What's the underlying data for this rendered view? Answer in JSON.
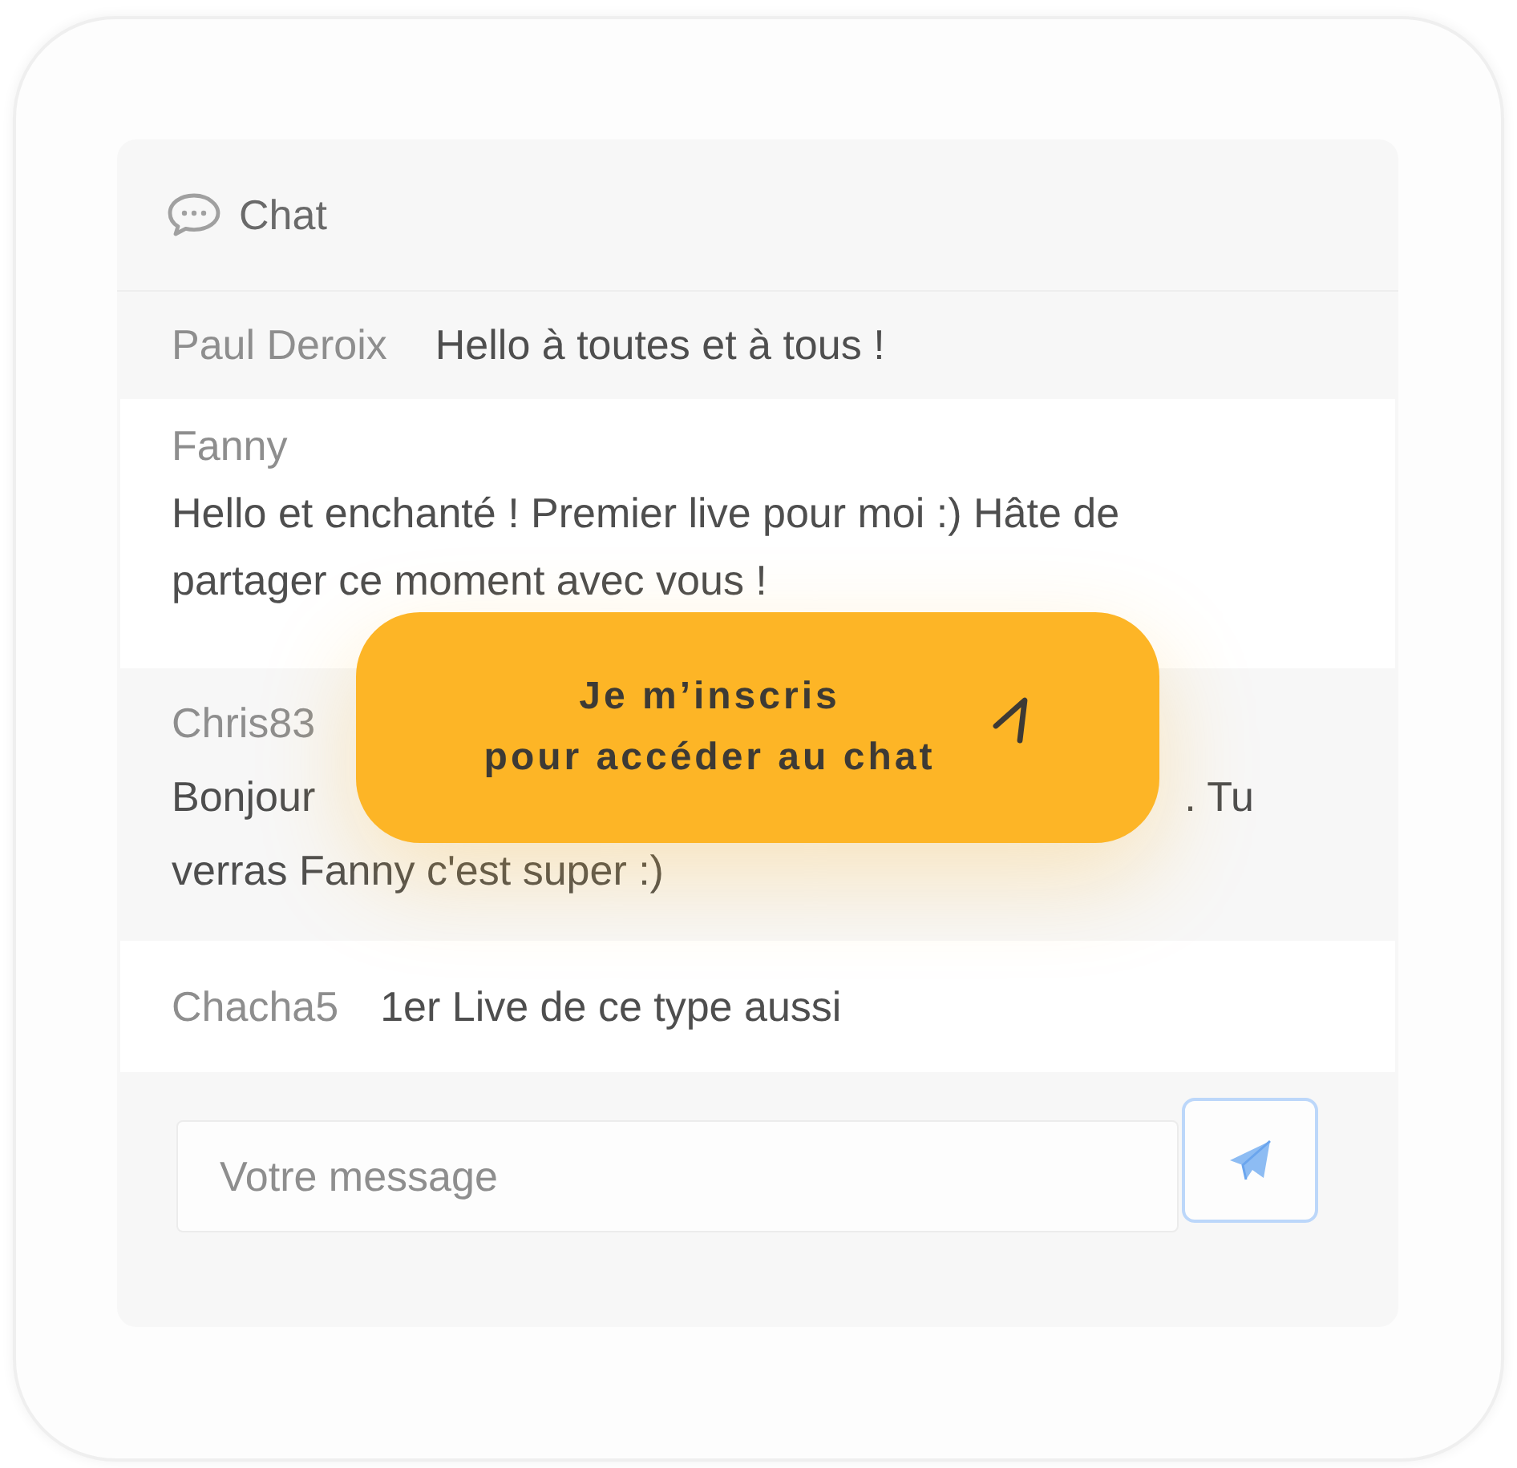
{
  "chat": {
    "title": "Chat",
    "messages": [
      {
        "author": "Paul Deroix",
        "kind": "inline",
        "lines": [
          [
            "Hello à toutes et à tous !"
          ]
        ]
      },
      {
        "author": "Fanny",
        "kind": "block",
        "lines": [
          [
            "Hello et enchanté ! Premier live pour moi :) Hâte de"
          ],
          [
            "partager ce moment avec vous !"
          ]
        ]
      },
      {
        "author": "Chris83",
        "kind": "block",
        "lines": [
          [
            "Bonjour",
            ". Tu"
          ],
          [
            "verras Fanny c'est super :)"
          ]
        ]
      },
      {
        "author": "Chacha5",
        "kind": "inline",
        "lines": [
          [
            "1er Live de ce type aussi"
          ]
        ]
      }
    ],
    "composer": {
      "placeholder": "Votre message"
    }
  },
  "signup_button": {
    "lines": [
      "Je m’inscris",
      "pour accéder au chat"
    ]
  }
}
